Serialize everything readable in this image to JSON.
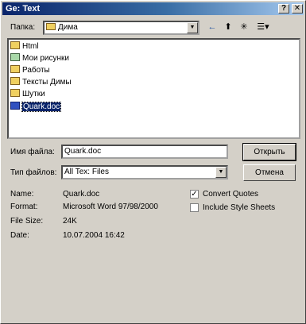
{
  "window": {
    "title": "Ge: Text",
    "help_label": "?",
    "close_label": "✕"
  },
  "lookin": {
    "label": "Папка:",
    "value": "Дима"
  },
  "toolbar": {
    "back_icon": "←",
    "up_icon": "⬆",
    "newfolder_icon": "✳",
    "view_icon": "☰▾"
  },
  "files": [
    {
      "name": "Html",
      "type": "folder"
    },
    {
      "name": "Мои рисунки",
      "type": "pictures"
    },
    {
      "name": "Работы",
      "type": "folder"
    },
    {
      "name": "Тексты Димы",
      "type": "folder"
    },
    {
      "name": "Шутки",
      "type": "folder"
    },
    {
      "name": "Quark.doc",
      "type": "doc",
      "selected": true
    }
  ],
  "filename": {
    "label": "Имя файла:",
    "value": "Quark.doc"
  },
  "filetype": {
    "label": "Тип файлов:",
    "value": "All Tex: Files"
  },
  "buttons": {
    "open": "Открыть",
    "cancel": "Отмена"
  },
  "info": {
    "name_label": "Name:",
    "name_value": "Quark.doc",
    "format_label": "Format:",
    "format_value": "Microsoft Word 97/98/2000",
    "size_label": "File Size:",
    "size_value": "24K",
    "date_label": "Date:",
    "date_value": "10.07.2004 16:42"
  },
  "options": {
    "convert_quotes": {
      "label": "Convert Quotes",
      "checked": true
    },
    "include_styles": {
      "label": "Include Style Sheets",
      "checked": false
    }
  }
}
